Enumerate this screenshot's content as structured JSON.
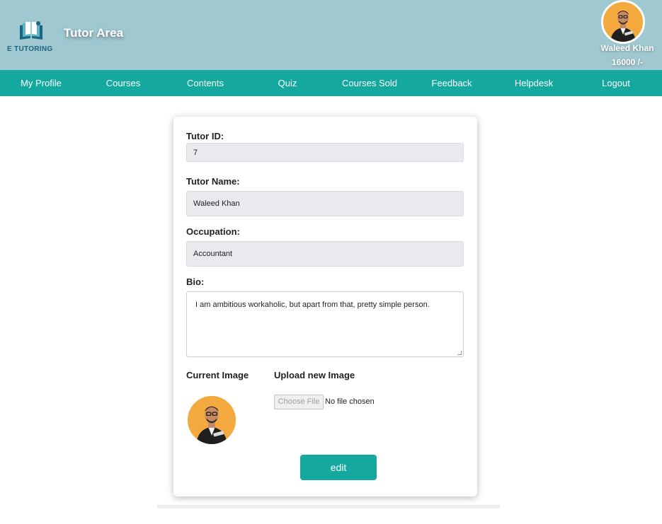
{
  "header": {
    "logo_text": "E TUTORING",
    "title": "Tutor Area",
    "user": {
      "name": "Waleed Khan",
      "balance": "16000 /-"
    }
  },
  "nav": [
    {
      "label": "My Profile"
    },
    {
      "label": "Courses"
    },
    {
      "label": "Contents"
    },
    {
      "label": "Quiz"
    },
    {
      "label": "Courses Sold"
    },
    {
      "label": "Feedback"
    },
    {
      "label": "Helpdesk"
    },
    {
      "label": "Logout"
    }
  ],
  "form": {
    "tutor_id": {
      "label": "Tutor ID:",
      "value": "7"
    },
    "tutor_name": {
      "label": "Tutor Name:",
      "value": "Waleed Khan"
    },
    "occupation": {
      "label": "Occupation:",
      "value": "Accountant"
    },
    "bio": {
      "label": "Bio:",
      "value": "I am ambitious workaholic, but apart from that, pretty simple person."
    },
    "current_image_label": "Current Image",
    "upload_label": "Upload new Image",
    "choose_file_label": "Choose File",
    "no_file_text": "No file chosen",
    "submit_label": "edit"
  },
  "colors": {
    "header_bg": "#a0c8d0",
    "nav_bg": "#14a89e",
    "accent": "#14a89e",
    "avatar_bg": "#f4a93e"
  }
}
